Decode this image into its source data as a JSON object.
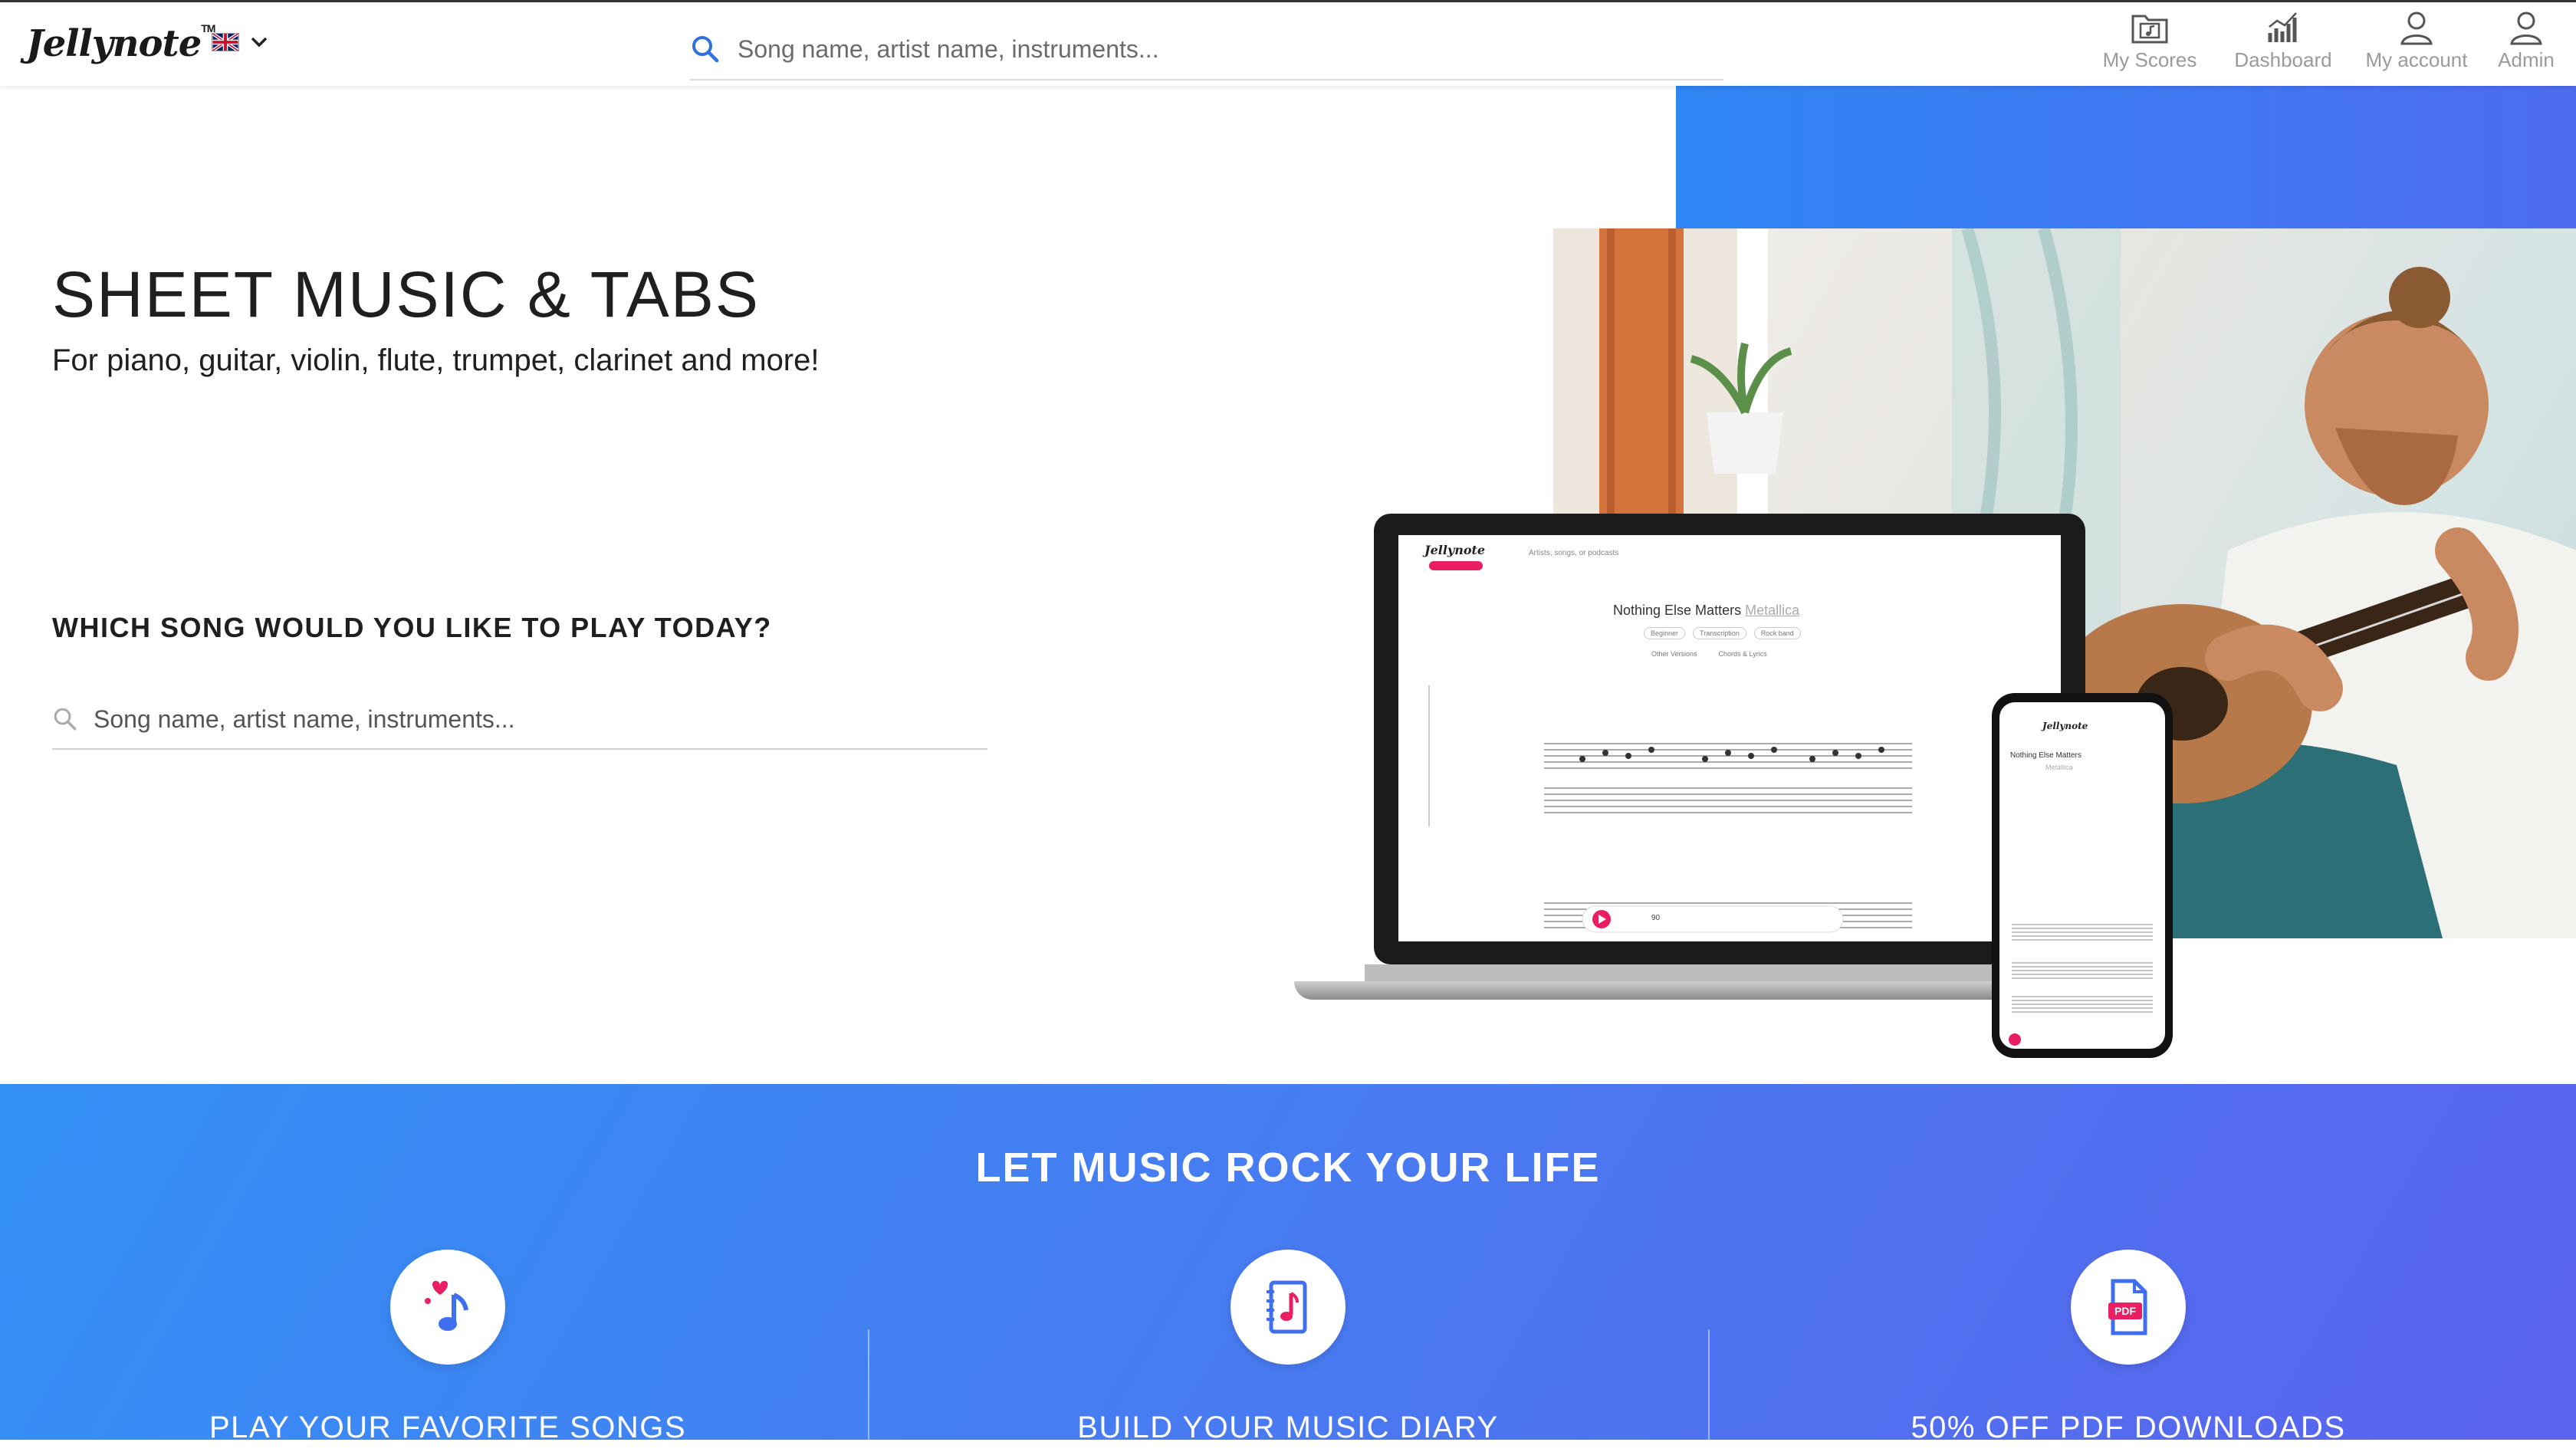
{
  "header": {
    "logo": "Jellynote",
    "logo_mark": "TM",
    "search_placeholder": "Song name, artist name, instruments...",
    "nav": [
      {
        "label": "My Scores"
      },
      {
        "label": "Dashboard"
      },
      {
        "label": "My account"
      },
      {
        "label": "Admin"
      }
    ]
  },
  "hero": {
    "title": "SHEET MUSIC & TABS",
    "subtitle": "For piano, guitar, violin, flute, trumpet, clarinet and more!",
    "question": "WHICH SONG WOULD YOU LIKE TO PLAY TODAY?",
    "search_placeholder": "Song name, artist name, instruments..."
  },
  "mockup": {
    "song_title": "Nothing Else Matters",
    "artist": "Metallica",
    "search_placeholder": "Artists, songs, or podcasts",
    "tags": [
      "Beginner",
      "Transcription",
      "Rock band"
    ],
    "links": [
      "Other Versions",
      "Chords & Lyrics"
    ],
    "tempo": "90"
  },
  "band": {
    "title": "LET MUSIC ROCK YOUR LIFE",
    "features": [
      {
        "title": "PLAY YOUR FAVORITE SONGS"
      },
      {
        "title": "BUILD YOUR MUSIC DIARY"
      },
      {
        "title": "50% OFF PDF DOWNLOADS",
        "icon_text": "PDF"
      }
    ]
  },
  "colors": {
    "accent_blue": "#2f86f5",
    "band_gradient_end": "#5a63ee",
    "pink": "#e91e63"
  }
}
